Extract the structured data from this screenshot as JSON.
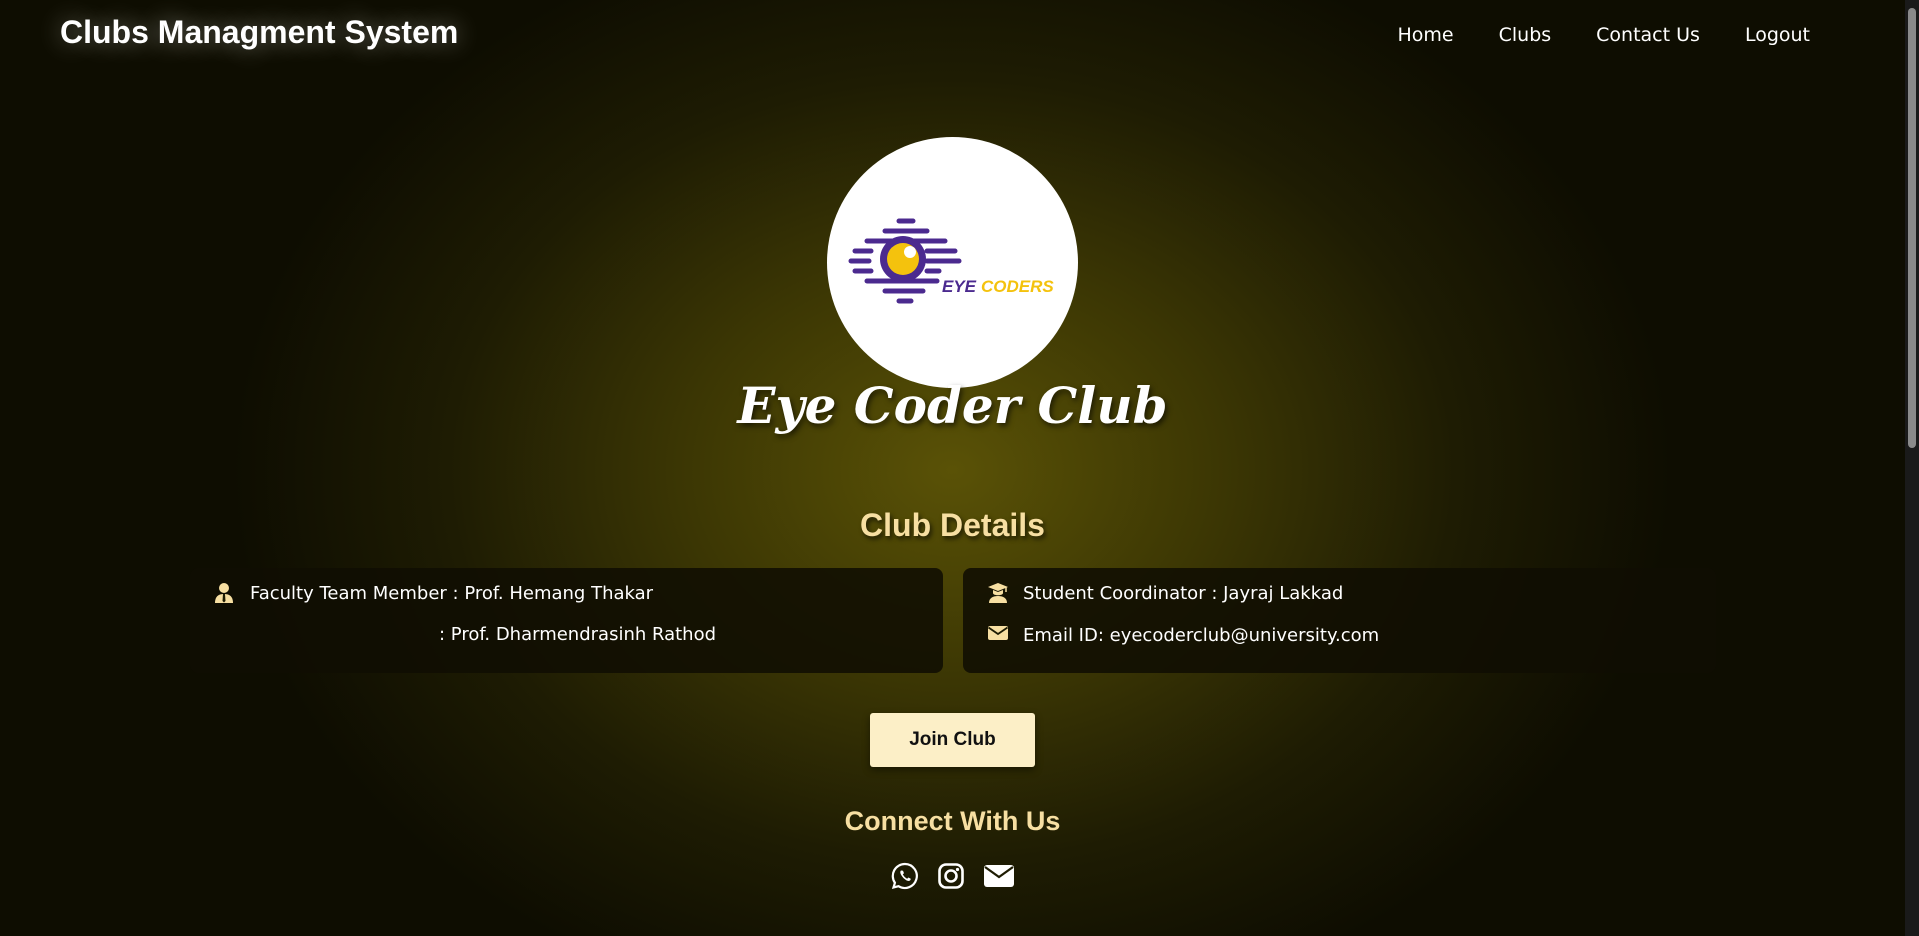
{
  "header": {
    "site_title": "Clubs Managment System",
    "nav": [
      "Home",
      "Clubs",
      "Contact Us",
      "Logout"
    ]
  },
  "club": {
    "logo_text_part1": "EYE",
    "logo_text_part2": "CODERS",
    "name": "Eye Coder Club"
  },
  "details": {
    "heading": "Club Details",
    "faculty_line1": "Faculty Team Member : Prof. Hemang Thakar",
    "faculty_line2": ": Prof. Dharmendrasinh Rathod",
    "student_coordinator": "Student Coordinator : Jayraj Lakkad",
    "email": "Email ID: eyecoderclub@university.com"
  },
  "join_button": "Join Club",
  "connect": {
    "heading": "Connect With Us",
    "icons": [
      "whatsapp-icon",
      "instagram-icon",
      "email-icon"
    ]
  },
  "colors": {
    "accent": "#f7dfa2",
    "button_bg": "#fcefc7",
    "logo_purple": "#4b2a8f",
    "logo_yellow": "#f4c20d"
  }
}
